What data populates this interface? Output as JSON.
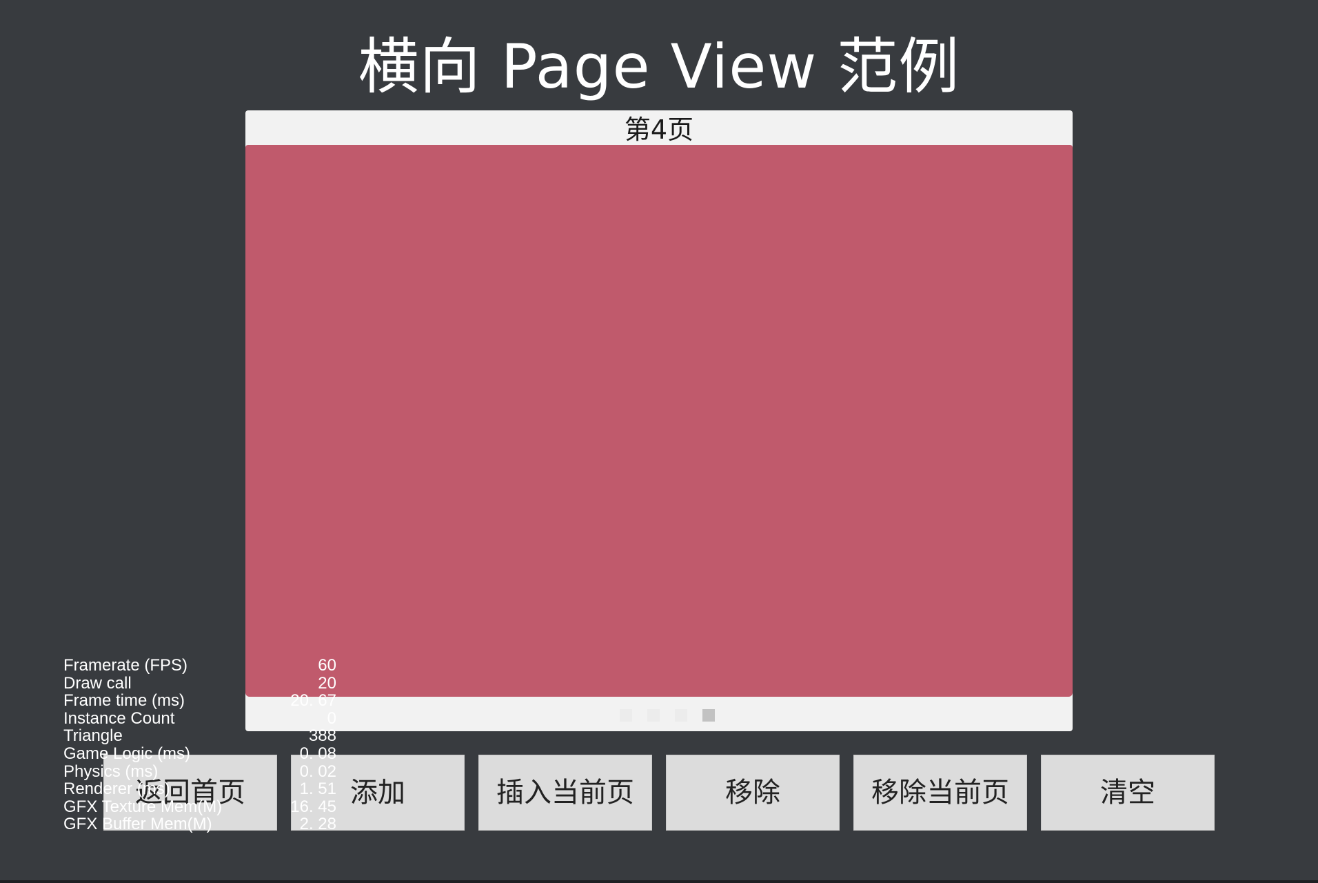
{
  "title": "横向 Page View 范例",
  "page_view": {
    "current_page_label": "第4页",
    "content_color": "#c05a6c",
    "indicator": {
      "count": 4,
      "active_index": 3
    }
  },
  "buttons": [
    {
      "label": "返回首页"
    },
    {
      "label": "添加"
    },
    {
      "label": "插入当前页"
    },
    {
      "label": "移除"
    },
    {
      "label": "移除当前页"
    },
    {
      "label": "清空"
    }
  ],
  "stats": [
    {
      "label": "Framerate (FPS)",
      "value": "60"
    },
    {
      "label": "Draw call",
      "value": "20"
    },
    {
      "label": "Frame time (ms)",
      "value": "20. 67"
    },
    {
      "label": "Instance Count",
      "value": "0"
    },
    {
      "label": "Triangle",
      "value": "388"
    },
    {
      "label": "Game Logic (ms)",
      "value": "0. 08"
    },
    {
      "label": "Physics (ms)",
      "value": "0. 02"
    },
    {
      "label": "Renderer (ms)",
      "value": "1. 51"
    },
    {
      "label": "GFX Texture Mem(M)",
      "value": "16. 45"
    },
    {
      "label": "GFX Buffer Mem(M)",
      "value": "2. 28"
    }
  ]
}
